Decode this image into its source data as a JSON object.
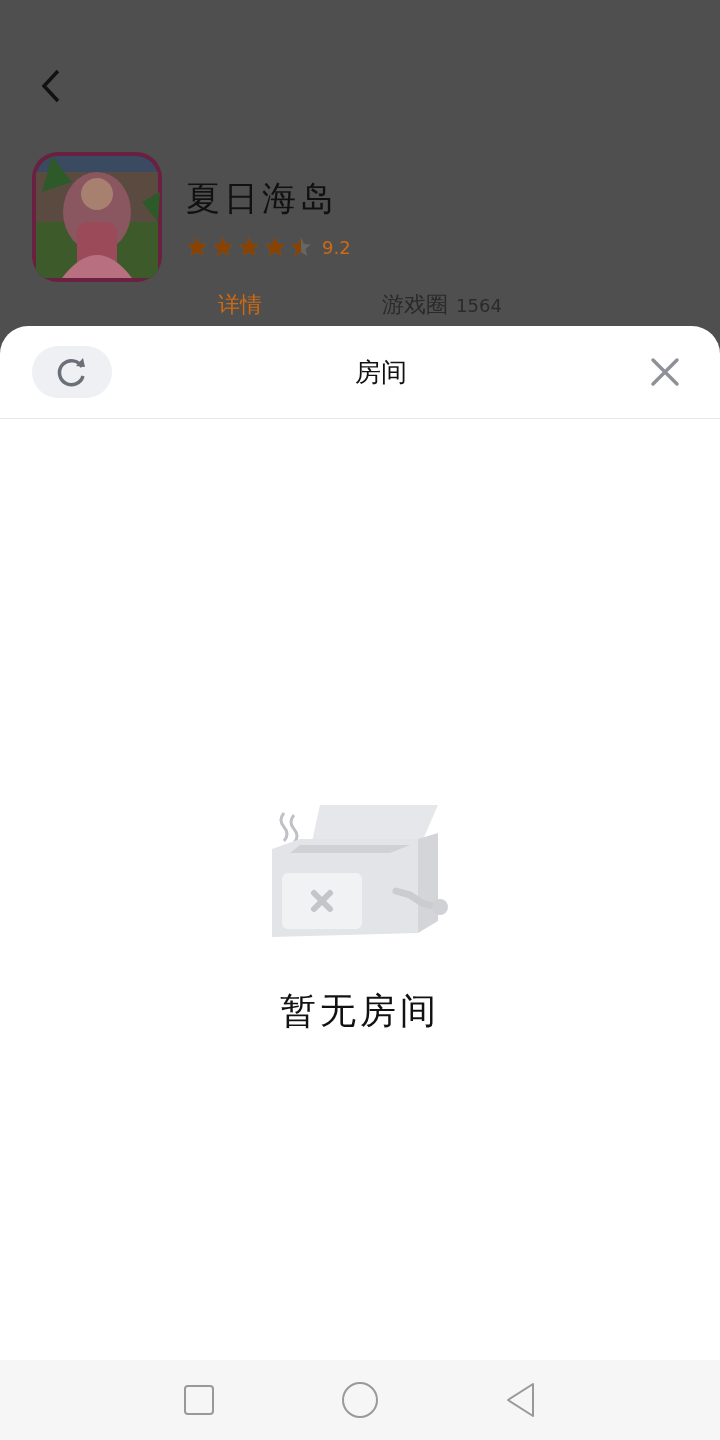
{
  "game": {
    "title": "夏日海岛",
    "stars": 4.5,
    "rating": "9.2"
  },
  "tabs": [
    {
      "label": "详情",
      "selected": true
    },
    {
      "label": "游戏圈",
      "count": "1564",
      "selected": false
    }
  ],
  "sheet": {
    "title": "房间",
    "empty_text": "暂无房间"
  }
}
